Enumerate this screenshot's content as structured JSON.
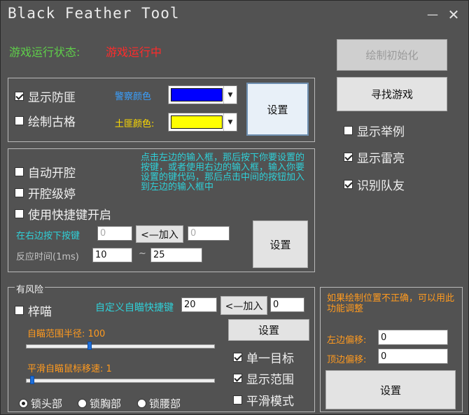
{
  "window": {
    "title": "Black Feather Tool",
    "minimize_icon": "minimize-icon",
    "close_icon": "close-icon"
  },
  "status": {
    "label": "游戏运行状态:",
    "value": "游戏运行中",
    "label_color": "#5fcf4a",
    "value_color": "#ff2b2b"
  },
  "right_panel": {
    "init_button": "绘制初始化",
    "find_game_button": "寻找游戏",
    "show_report": {
      "label": "显示举例",
      "checked": false
    },
    "show_thunder": {
      "label": "显示雷亮",
      "checked": true
    },
    "identify_team": {
      "label": "识别队友",
      "checked": true
    }
  },
  "group1": {
    "show_defense": {
      "label": "显示防匪",
      "checked": true
    },
    "draw_grid": {
      "label": "绘制古格",
      "checked": false
    },
    "police_color_label": "警察颜色",
    "bandit_color_label": "土匪颜色:",
    "police_color": "#0000ff",
    "bandit_color": "#ffff00",
    "set_button": "设置"
  },
  "group2": {
    "auto_fire": {
      "label": "自动开腔",
      "checked": false
    },
    "fire_level": {
      "label": "开腔级婷",
      "checked": false
    },
    "use_hotkey": {
      "label": "使用快捷键开启",
      "checked": false
    },
    "hint": "点击左边的输入框，那后按下你要设置的按键，或者使用右边的输入框，输入你要设置的键代码，那后点击中间的按钮加入到左边的输入框中",
    "press_key_label": "在右边按下按键",
    "key_input": "0",
    "add_button": "<—加入",
    "key_code_input": "0",
    "reaction_label": "反应时间(1ms)",
    "reaction_min": "10",
    "tilde": "~",
    "reaction_max": "25",
    "set_button": "设置"
  },
  "risk_group": {
    "legend": "有风险",
    "aim": {
      "label": "梓喵",
      "checked": false
    },
    "custom_hotkey_label": "自定义自瞄快捷键",
    "hotkey_input": "20",
    "add_button": "<—加入",
    "hotkey_code_input": "0",
    "set_button": "设置",
    "aim_radius_label": "自瞄范围半径: 100",
    "aim_radius_fraction": 0.33,
    "smooth_label": "平滑自瞄鼠标移速: 1",
    "smooth_fraction": 0.02,
    "single_target": {
      "label": "单一目标",
      "checked": true
    },
    "show_range": {
      "label": "显示范围",
      "checked": true
    },
    "smooth_mode": {
      "label": "平滑模式",
      "checked": false
    },
    "radios": [
      {
        "label": "锁头部",
        "checked": true
      },
      {
        "label": "锁胸部",
        "checked": false
      },
      {
        "label": "锁腰部",
        "checked": false
      }
    ]
  },
  "offset_group": {
    "hint": "如果绘制位置不正确，可以用此功能调整",
    "left_offset_label": "左边偏移:",
    "left_offset": "0",
    "top_offset_label": "顶边偏移:",
    "top_offset": "0",
    "set_button": "设置"
  }
}
